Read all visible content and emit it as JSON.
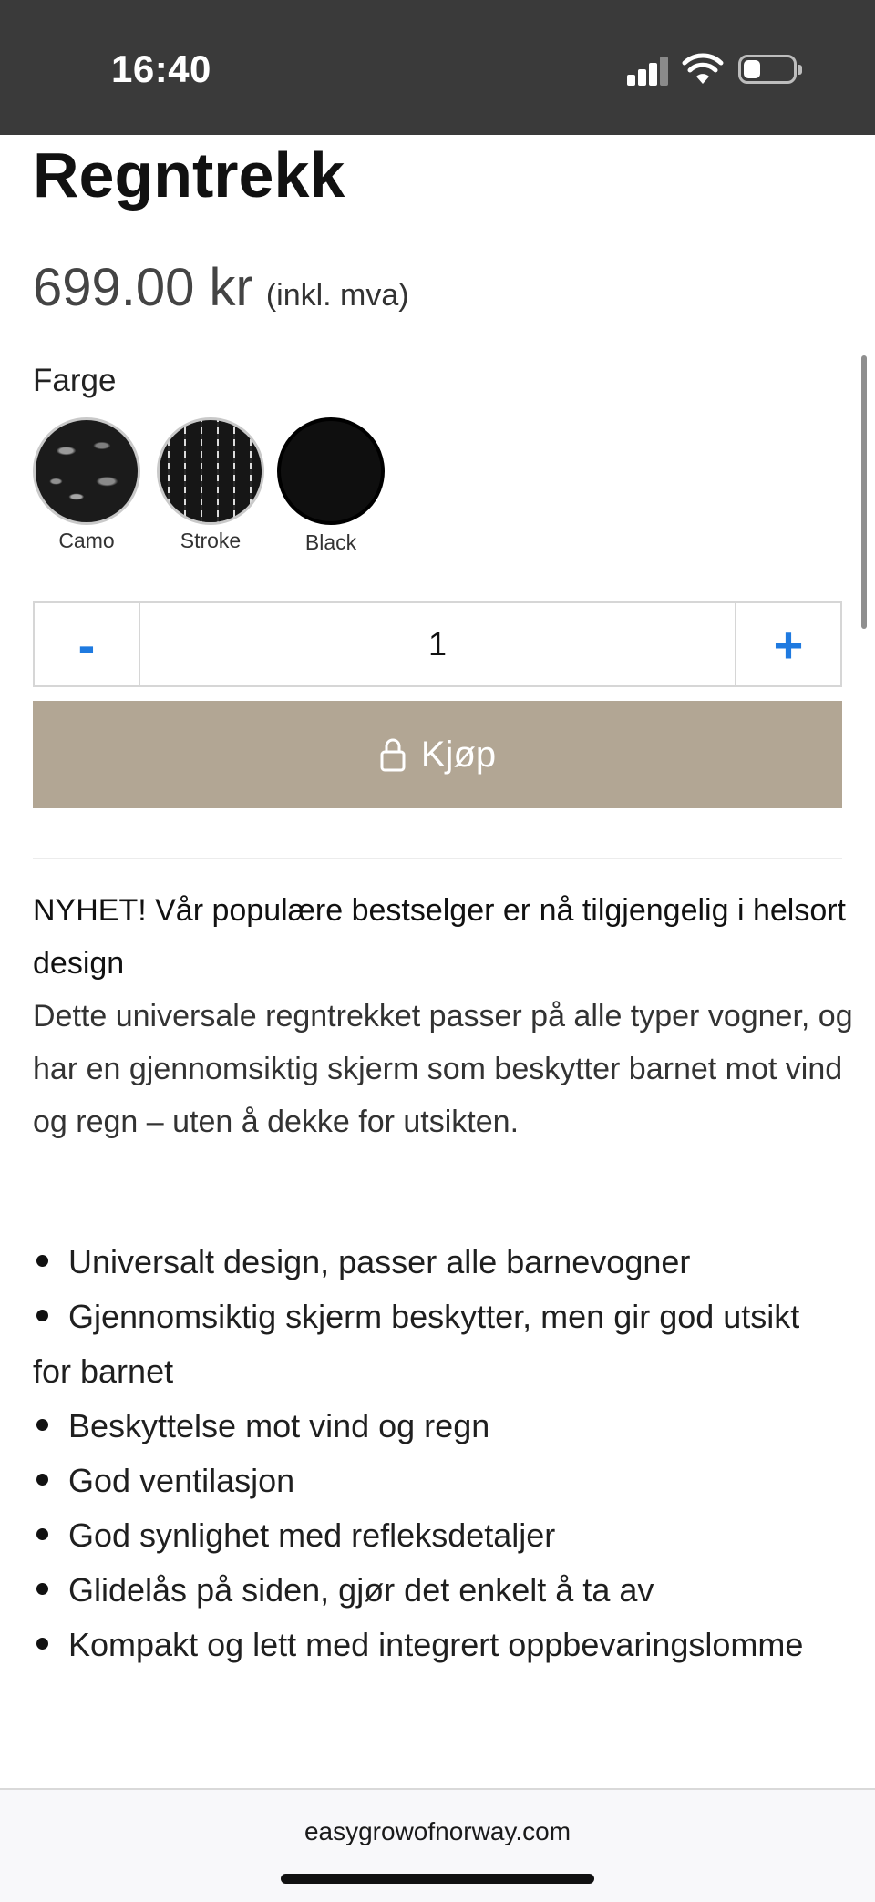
{
  "status_bar": {
    "time": "16:40",
    "signal_icon": "cellular-signal-icon",
    "wifi_icon": "wifi-icon",
    "battery_icon": "battery-icon",
    "battery_level": 0.25
  },
  "product": {
    "title": "Regntrekk",
    "price": "699.00 kr",
    "price_suffix": "(inkl. mva)"
  },
  "color_selector": {
    "label": "Farge",
    "options": [
      {
        "name": "Camo"
      },
      {
        "name": "Stroke"
      },
      {
        "name": "Black"
      }
    ]
  },
  "quantity": {
    "minus_label": "-",
    "value": "1",
    "plus_label": "+"
  },
  "buy_button": {
    "label": "Kjøp",
    "icon": "lock-icon",
    "color": "#b2a694"
  },
  "description": {
    "heading": "NYHET! Vår populære bestselger er nå tilgjengelig i helsort design",
    "body": "Dette universale regntrekket passer på alle typer vogner, og har en gjennomsiktig skjerm som beskytter barnet mot vind og regn – uten å dekke for utsikten."
  },
  "features": [
    "Universalt design, passer alle barnevogner",
    "Gjennomsiktig skjerm beskytter, men gir god utsikt for barnet",
    "Beskyttelse mot vind og regn",
    "God ventilasjon",
    "God synlighet med refleksdetaljer",
    "Glidelås på siden, gjør det enkelt å ta av",
    "Kompakt og lett med integrert oppbevaringslomme"
  ],
  "browser": {
    "url": "easygrowofnorway.com"
  },
  "colors": {
    "accent": "#1f7ae0",
    "status_bar": "#3a3a3a"
  }
}
